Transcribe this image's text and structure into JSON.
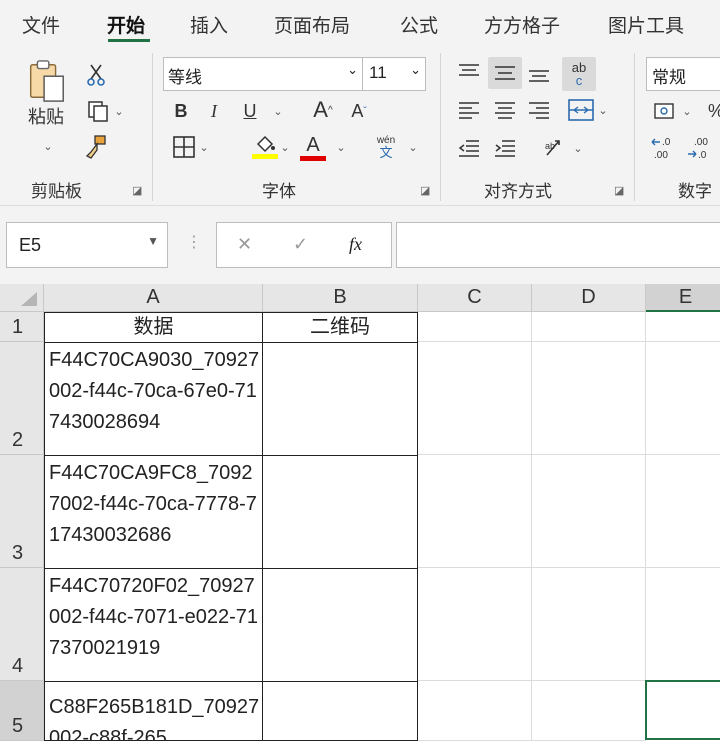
{
  "tabs": [
    {
      "label": "文件"
    },
    {
      "label": "开始"
    },
    {
      "label": "插入"
    },
    {
      "label": "页面布局"
    },
    {
      "label": "公式"
    },
    {
      "label": "方方格子"
    },
    {
      "label": "图片工具"
    }
  ],
  "ribbon": {
    "clipboard": {
      "label": "剪贴板",
      "paste_label": "粘贴"
    },
    "font": {
      "label": "字体",
      "font_name": "等线",
      "font_size": "11",
      "bold": "B",
      "italic": "I",
      "underline": "U",
      "grow": "A",
      "shrink": "A",
      "phonetic_top": "wén",
      "phonetic_bottom": "文",
      "font_color_letter": "A",
      "fill_color": "#ffff00",
      "font_color": "#e00000"
    },
    "alignment": {
      "label": "对齐方式",
      "wrap_top": "ab",
      "wrap_bottom": "c"
    },
    "number": {
      "label": "数字",
      "format": "常规"
    }
  },
  "formula_bar": {
    "name_box": "E5",
    "fx": "fx",
    "cancel": "✕",
    "enter": "✓",
    "formula": ""
  },
  "columns": [
    "A",
    "B",
    "C",
    "D",
    "E"
  ],
  "rows": [
    {
      "num": "1",
      "a": "数据",
      "b": "二维码"
    },
    {
      "num": "2",
      "a": "F44C70CA9030_70927002-f44c-70ca-67e0-717430028694",
      "b": ""
    },
    {
      "num": "3",
      "a": "F44C70CA9FC8_70927002-f44c-70ca-7778-717430032686",
      "b": ""
    },
    {
      "num": "4",
      "a": "F44C70720F02_70927002-f44c-7071-e022-717370021919",
      "b": ""
    },
    {
      "num": "5",
      "a": "C88F265B181D_70927002-c88f-265",
      "b": ""
    }
  ],
  "accent": "#217346"
}
